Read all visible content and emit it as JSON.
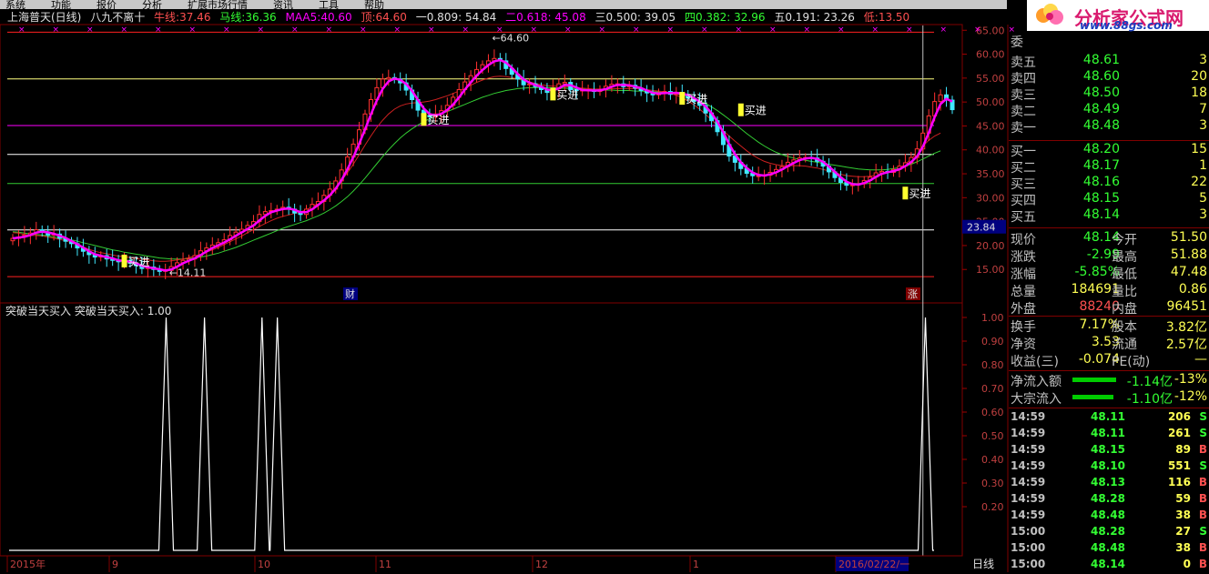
{
  "menu": [
    "系统",
    "功能",
    "报价",
    "分析",
    "扩展市场行情",
    "资讯",
    "工具",
    "帮助"
  ],
  "logo": {
    "title": "分析家公式网",
    "url": "www.88gs.com"
  },
  "header": {
    "stock": "上海普天(日线)",
    "formula": "八九不离十",
    "ma1_label": "牛线:",
    "ma1_value": "37.46",
    "ma2_label": "马线:",
    "ma2_value": "36.36",
    "ma3_label": "MAA5:",
    "ma3_value": "40.60",
    "top_label": "顶:",
    "top_value": "64.60",
    "f1": "一0.809: 54.84",
    "f2": "二0.618: 45.08",
    "f3": "三0.500: 39.05",
    "f4": "四0.382: 32.96",
    "f5": "五0.191: 23.26",
    "low_label": "低:",
    "low_value": "13.50"
  },
  "chart_data": {
    "type": "candlestick",
    "ylim": [
      12,
      66
    ],
    "y_ticks": [
      "65.00",
      "60.00",
      "55.00",
      "50.00",
      "45.00",
      "40.00",
      "35.00",
      "30.00",
      "25.00",
      "20.00",
      "15.00"
    ],
    "cursor_value": "23.84",
    "x_labels": [
      "2015年",
      "9",
      "10",
      "11",
      "12",
      "1",
      "2016/02/22/一"
    ],
    "fib_lines": [
      64.6,
      54.84,
      45.08,
      39.05,
      32.96,
      23.26,
      13.5
    ],
    "annotations": {
      "high": "64.60",
      "low": "14.11",
      "buy": "买进",
      "cai": "财",
      "zhang": "涨"
    },
    "period_label": "日线",
    "indicator": {
      "title": "突破当天买入",
      "value_text": "突破当天买入: 1.00",
      "y_ticks": [
        "1.00",
        "0.90",
        "0.80",
        "0.70",
        "0.60",
        "0.50",
        "0.40",
        "0.30",
        "0.20"
      ],
      "spikes_x_days": [
        40,
        50,
        65,
        69,
        238
      ]
    },
    "close": [
      21.5,
      21.8,
      22.2,
      22.6,
      23.3,
      22.8,
      22.2,
      22.4,
      21.5,
      20.9,
      20.4,
      19.5,
      18.8,
      18.1,
      17.6,
      17.9,
      17.2,
      16.9,
      16.6,
      16.9,
      16.3,
      15.8,
      15.2,
      15.5,
      15.0,
      14.6,
      14.8,
      15.6,
      16.4,
      16.9,
      17.2,
      17.9,
      18.9,
      19.5,
      20.1,
      20.6,
      21.2,
      22.1,
      22.8,
      23.4,
      24.2,
      25.0,
      26.5,
      27.1,
      27.3,
      27.6,
      28.0,
      27.6,
      26.8,
      26.5,
      27.6,
      28.6,
      29.2,
      30.5,
      31.8,
      33.5,
      35.8,
      38.5,
      41.2,
      44.2,
      47.5,
      50.5,
      53.0,
      54.8,
      55.1,
      54.8,
      54.0,
      52.5,
      50.5,
      48.3,
      47.2,
      46.9,
      47.5,
      48.2,
      49.3,
      51.0,
      52.6,
      54.2,
      55.5,
      56.8,
      57.8,
      58.6,
      59.1,
      58.6,
      57.0,
      55.8,
      54.8,
      53.6,
      53.8,
      53.2,
      52.6,
      52.0,
      52.8,
      53.8,
      54.1,
      52.6,
      52.4,
      52.5,
      52.5,
      52.2,
      52.6,
      53.3,
      53.7,
      53.8,
      53.2,
      53.5,
      52.9,
      52.4,
      51.9,
      51.5,
      51.9,
      52.2,
      51.6,
      52.0,
      51.6,
      50.8,
      50.1,
      49.3,
      47.7,
      46.1,
      43.8,
      41.1,
      38.7,
      37.4,
      36.1,
      35.1,
      34.6,
      34.6,
      34.7,
      35.3,
      35.9,
      36.5,
      37.4,
      37.9,
      38.3,
      38.4,
      38.3,
      37.6,
      36.6,
      35.4,
      34.2,
      33.2,
      32.6,
      32.7,
      32.9,
      33.6,
      34.3,
      35.2,
      35.5,
      35.3,
      35.9,
      36.6,
      37.3,
      38.4,
      40.2,
      43.5,
      47.1,
      50.1,
      51.5,
      50.4,
      48.4
    ],
    "ma_white": [
      22.7,
      22.6,
      22.3,
      22.1,
      22.1,
      22.0,
      21.8,
      21.5,
      21.3,
      21.0,
      20.6,
      20.2,
      19.7,
      19.2,
      18.8,
      18.5,
      18.3,
      18.0,
      17.8,
      17.7,
      17.5,
      17.3,
      17.1,
      17.0,
      16.8,
      16.7,
      16.7,
      16.8,
      17.0,
      17.2,
      17.5,
      17.8,
      18.2,
      18.6,
      19.1,
      19.6,
      20.2,
      20.8,
      21.4,
      22.0,
      22.7,
      23.3,
      24.0,
      24.6,
      25.2,
      25.7,
      26.1,
      26.4,
      26.7,
      27.0,
      27.5,
      28.1,
      28.8,
      29.7,
      30.8,
      32.1,
      33.6,
      35.2,
      37.0,
      39.0,
      41.0,
      42.9,
      44.7,
      46.2,
      47.5,
      48.5,
      49.2,
      49.6,
      49.8,
      49.9,
      50.0,
      50.2,
      50.5,
      50.9,
      51.3,
      51.8,
      52.3,
      52.9,
      53.5,
      54.1,
      54.6,
      55.0,
      55.3,
      55.4,
      55.3,
      55.1,
      54.8,
      54.5,
      54.2,
      53.9,
      53.6,
      53.4,
      53.3,
      53.3,
      53.2,
      53.1,
      53.0,
      52.9,
      52.8,
      52.7,
      52.7,
      52.7,
      52.8,
      52.8,
      52.8,
      52.8,
      52.8,
      52.7,
      52.6,
      52.4,
      52.3,
      52.1,
      51.8,
      51.4,
      50.9,
      50.2,
      49.4,
      48.5,
      47.4,
      46.3,
      45.1,
      44.0,
      42.9,
      41.8,
      40.8,
      39.8,
      38.9,
      38.2,
      37.6,
      37.2,
      36.9,
      36.7,
      36.7,
      36.7,
      36.7,
      36.6,
      36.4,
      36.2,
      35.9,
      35.6,
      35.2,
      34.9,
      34.6,
      34.5,
      34.4,
      34.4,
      34.5,
      34.7,
      34.9,
      35.2,
      35.6,
      36.2,
      37.0,
      38.1,
      39.4,
      40.8,
      42.0,
      42.9,
      43.5
    ],
    "ma_green": [
      22.9,
      22.8,
      22.6,
      22.4,
      22.3,
      22.2,
      22.0,
      21.8,
      21.6,
      21.4,
      21.2,
      20.9,
      20.6,
      20.3,
      20.0,
      19.7,
      19.4,
      19.1,
      18.9,
      18.6,
      18.4,
      18.2,
      18.0,
      17.8,
      17.6,
      17.4,
      17.3,
      17.2,
      17.2,
      17.2,
      17.3,
      17.4,
      17.6,
      17.8,
      18.1,
      18.4,
      18.8,
      19.2,
      19.6,
      20.1,
      20.6,
      21.1,
      21.6,
      22.1,
      22.6,
      23.1,
      23.6,
      24.0,
      24.4,
      24.8,
      25.2,
      25.7,
      26.2,
      26.8,
      27.5,
      28.3,
      29.2,
      30.2,
      31.4,
      32.7,
      34.1,
      35.6,
      37.1,
      38.6,
      40.0,
      41.3,
      42.5,
      43.5,
      44.4,
      45.2,
      45.9,
      46.5,
      47.0,
      47.5,
      48.0,
      48.5,
      49.0,
      49.5,
      50.0,
      50.5,
      51.0,
      51.4,
      51.8,
      52.1,
      52.4,
      52.6,
      52.8,
      52.9,
      53.0,
      53.0,
      53.0,
      53.0,
      53.0,
      52.9,
      52.9,
      52.8,
      52.8,
      52.7,
      52.6,
      52.6,
      52.5,
      52.5,
      52.5,
      52.4,
      52.4,
      52.4,
      52.3,
      52.3,
      52.2,
      52.2,
      52.1,
      52.0,
      51.9,
      51.7,
      51.5,
      51.2,
      50.8,
      50.3,
      49.7,
      49.0,
      48.2,
      47.3,
      46.4,
      45.4,
      44.4,
      43.4,
      42.5,
      41.6,
      40.8,
      40.1,
      39.5,
      39.0,
      38.6,
      38.3,
      38.0,
      37.8,
      37.6,
      37.4,
      37.2,
      37.0,
      36.8,
      36.6,
      36.4,
      36.2,
      36.0,
      35.9,
      35.8,
      35.8,
      35.8,
      35.9,
      36.1,
      36.3,
      36.6,
      37.0,
      37.5,
      38.1,
      38.7,
      39.3,
      39.8
    ]
  },
  "quote": {
    "weibi_label": "委",
    "asks": [
      {
        "label": "卖五",
        "price": "48.61",
        "vol": "3"
      },
      {
        "label": "卖四",
        "price": "48.60",
        "vol": "20"
      },
      {
        "label": "卖三",
        "price": "48.50",
        "vol": "18"
      },
      {
        "label": "卖二",
        "price": "48.49",
        "vol": "7"
      },
      {
        "label": "卖一",
        "price": "48.48",
        "vol": "3"
      }
    ],
    "bids": [
      {
        "label": "买一",
        "price": "48.20",
        "vol": "15"
      },
      {
        "label": "买二",
        "price": "48.17",
        "vol": "1"
      },
      {
        "label": "买三",
        "price": "48.16",
        "vol": "22"
      },
      {
        "label": "买四",
        "price": "48.15",
        "vol": "5"
      },
      {
        "label": "买五",
        "price": "48.14",
        "vol": "3"
      }
    ],
    "stats": [
      {
        "l1": "现价",
        "v1": "48.14",
        "l2": "今开",
        "v2": "51.50"
      },
      {
        "l1": "涨跌",
        "v1": "-2.99",
        "l2": "最高",
        "v2": "51.88"
      },
      {
        "l1": "涨幅",
        "v1": "-5.85%",
        "l2": "最低",
        "v2": "47.48"
      },
      {
        "l1": "总量",
        "v1": "184691",
        "l2": "量比",
        "v2": "0.86"
      },
      {
        "l1": "外盘",
        "v1": "88240",
        "l2": "内盘",
        "v2": "96451"
      }
    ],
    "stats2": [
      {
        "l1": "换手",
        "v1": "7.17%",
        "l2": "股本",
        "v2": "3.82亿"
      },
      {
        "l1": "净资",
        "v1": "3.53",
        "l2": "流通",
        "v2": "2.57亿"
      },
      {
        "l1": "收益(三)",
        "v1": "-0.074",
        "l2": "PE(动)",
        "v2": "—"
      }
    ],
    "flows": [
      {
        "label": "净流入额",
        "value": "-1.14亿",
        "pct": "-13%"
      },
      {
        "label": "大宗流入",
        "value": "-1.10亿",
        "pct": "-12%"
      }
    ],
    "ticks": [
      {
        "time": "14:59",
        "price": "48.11",
        "vol": "206",
        "bs": "S"
      },
      {
        "time": "14:59",
        "price": "48.11",
        "vol": "261",
        "bs": "S"
      },
      {
        "time": "14:59",
        "price": "48.15",
        "vol": "89",
        "bs": "B"
      },
      {
        "time": "14:59",
        "price": "48.10",
        "vol": "551",
        "bs": "S"
      },
      {
        "time": "14:59",
        "price": "48.13",
        "vol": "116",
        "bs": "B"
      },
      {
        "time": "14:59",
        "price": "48.28",
        "vol": "59",
        "bs": "B"
      },
      {
        "time": "14:59",
        "price": "48.48",
        "vol": "38",
        "bs": "B"
      },
      {
        "time": "15:00",
        "price": "48.28",
        "vol": "27",
        "bs": "S"
      },
      {
        "time": "15:00",
        "price": "48.48",
        "vol": "38",
        "bs": "B"
      },
      {
        "time": "15:00",
        "price": "48.14",
        "vol": "0",
        "bs": "B"
      }
    ]
  }
}
